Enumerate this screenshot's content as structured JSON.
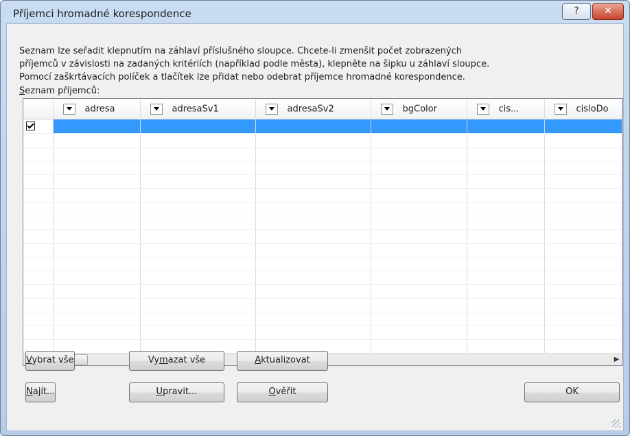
{
  "window": {
    "title": "Příjemci hromadné korespondence",
    "help_label": "?",
    "close_label": "✕"
  },
  "description": {
    "line1": "Seznam lze seřadit klepnutím na záhlaví příslušného sloupce. Chcete-li zmenšit počet zobrazených",
    "line2": "příjemců v závislosti na zadaných kritériích (například podle města), klepněte na šipku u záhlaví sloupce.",
    "line3": "Pomocí zaškrtávacích políček a tlačítek lze přidat nebo odebrat příjemce hromadné korespondence."
  },
  "list": {
    "label_first": "S",
    "label_rest": "eznam příjemců:",
    "columns": [
      "adresa",
      "adresaSv1",
      "adresaSv2",
      "bgColor",
      "cis...",
      "cisloDo"
    ],
    "rows": [
      {
        "checked": true,
        "selected": true
      }
    ]
  },
  "scrollbar": {
    "left_arrow": "◀",
    "right_arrow": "▶",
    "thumb_grip": "III"
  },
  "buttons": {
    "select_all": {
      "u": "V",
      "rest": "ybrat vše"
    },
    "clear_all": {
      "pre": "Vy",
      "u": "m",
      "rest": "azat vše"
    },
    "refresh": {
      "u": "A",
      "rest": "ktualizovat"
    },
    "find": {
      "u": "N",
      "rest": "ajít..."
    },
    "edit": {
      "u": "U",
      "rest": "pravit..."
    },
    "validate": {
      "u": "O",
      "rest": "věřit"
    },
    "ok": "OK"
  },
  "colors": {
    "selection": "#3399ff",
    "close_button": "#c4452b",
    "title_bar": "#c9dcf1"
  }
}
